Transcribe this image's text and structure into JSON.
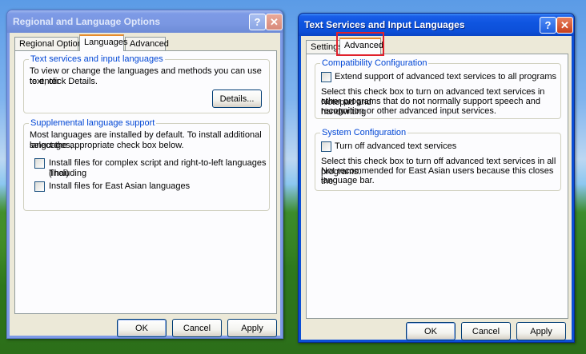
{
  "left_window": {
    "title": "Regional and Language Options",
    "tabs": [
      "Regional Options",
      "Languages",
      "Advanced"
    ],
    "group_text_services": {
      "legend": "Text services and input languages",
      "description_line1": "To view or change the languages and methods you can use to enter",
      "description_line2": "text, click Details.",
      "details_button": "Details..."
    },
    "group_supplemental": {
      "legend": "Supplemental language support",
      "description_line1": "Most languages are installed by default. To install additional languages,",
      "description_line2": "select the appropriate check box below.",
      "checkbox1_line1": "Install files for complex script and right-to-left languages (including",
      "checkbox1_line2": "Thai)",
      "checkbox2": "Install files for East Asian languages"
    },
    "buttons": {
      "ok": "OK",
      "cancel": "Cancel",
      "apply": "Apply"
    }
  },
  "right_window": {
    "title": "Text Services and Input Languages",
    "tabs": [
      "Settings",
      "Advanced"
    ],
    "group_compat": {
      "legend": "Compatibility Configuration",
      "checkbox": "Extend support of advanced text services to all programs",
      "description_line1": "Select this check box to turn on advanced text services in Notepad and",
      "description_line2": "other programs that do not normally support speech and handwriting",
      "description_line3": "recognition or other advanced input services."
    },
    "group_system": {
      "legend": "System Configuration",
      "checkbox": "Turn off advanced text services",
      "description_line1": "Select this check box to turn off advanced text services in all programs.",
      "description_line2": "Not recommended for East Asian users because this closes the",
      "description_line3": "language bar."
    },
    "buttons": {
      "ok": "OK",
      "cancel": "Cancel",
      "apply": "Apply"
    }
  },
  "icons": {
    "help": "?",
    "close": "✕"
  },
  "colors": {
    "highlight": "#e0202c",
    "legend_text": "#0046d5",
    "active_tab_accent": "#e68b2c"
  }
}
